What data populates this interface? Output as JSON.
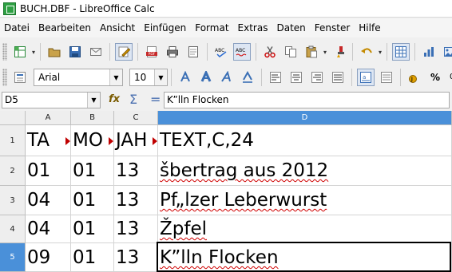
{
  "window": {
    "title": "BUCH.DBF - LibreOffice Calc"
  },
  "menu": [
    "Datei",
    "Bearbeiten",
    "Ansicht",
    "Einfügen",
    "Format",
    "Extras",
    "Daten",
    "Fenster",
    "Hilfe"
  ],
  "format_toolbar": {
    "font_name": "Arial",
    "font_size": "10"
  },
  "formula_bar": {
    "cell_ref": "D5",
    "fx_label": "fx",
    "sum_symbol": "Σ",
    "equals_symbol": "=",
    "content": "K”lln Flocken"
  },
  "sheet": {
    "columns": [
      "A",
      "B",
      "C",
      "D"
    ],
    "selected_column": "D",
    "selected_row": "5",
    "rows": [
      {
        "num": "1",
        "cells": [
          "TA",
          "MO",
          "JAH",
          "TEXT,C,24"
        ]
      },
      {
        "num": "2",
        "cells": [
          "01",
          "01",
          "13",
          "šbertrag aus 2012"
        ]
      },
      {
        "num": "3",
        "cells": [
          "04",
          "01",
          "13",
          "Pf„lzer Leberwurst"
        ]
      },
      {
        "num": "4",
        "cells": [
          "04",
          "01",
          "13",
          "Žpfel"
        ]
      },
      {
        "num": "5",
        "cells": [
          "09",
          "01",
          "13",
          "K”lln Flocken"
        ]
      }
    ]
  },
  "icons": {
    "toolbar1": [
      "new-icon",
      "open-icon",
      "save-icon",
      "email-icon",
      "edit-mode-icon",
      "export-pdf-icon",
      "print-icon",
      "print-preview-icon",
      "spellcheck-icon",
      "autospellcheck-icon",
      "cut-icon",
      "copy-icon",
      "paste-icon",
      "clone-format-icon",
      "undo-icon",
      "grid-icon",
      "navigator-icon",
      "gallery-icon"
    ],
    "toolbar2": [
      "font-color-icon",
      "bold-icon",
      "italic-icon",
      "underline-icon",
      "align-left-icon",
      "align-center-icon",
      "align-right-icon",
      "justify-icon",
      "merge-icon",
      "wrap-icon",
      "currency-icon",
      "percent-icon"
    ]
  },
  "colors": {
    "selection": "#4a90d9",
    "squiggle": "#d00000",
    "clip_marker": "#c00000"
  }
}
